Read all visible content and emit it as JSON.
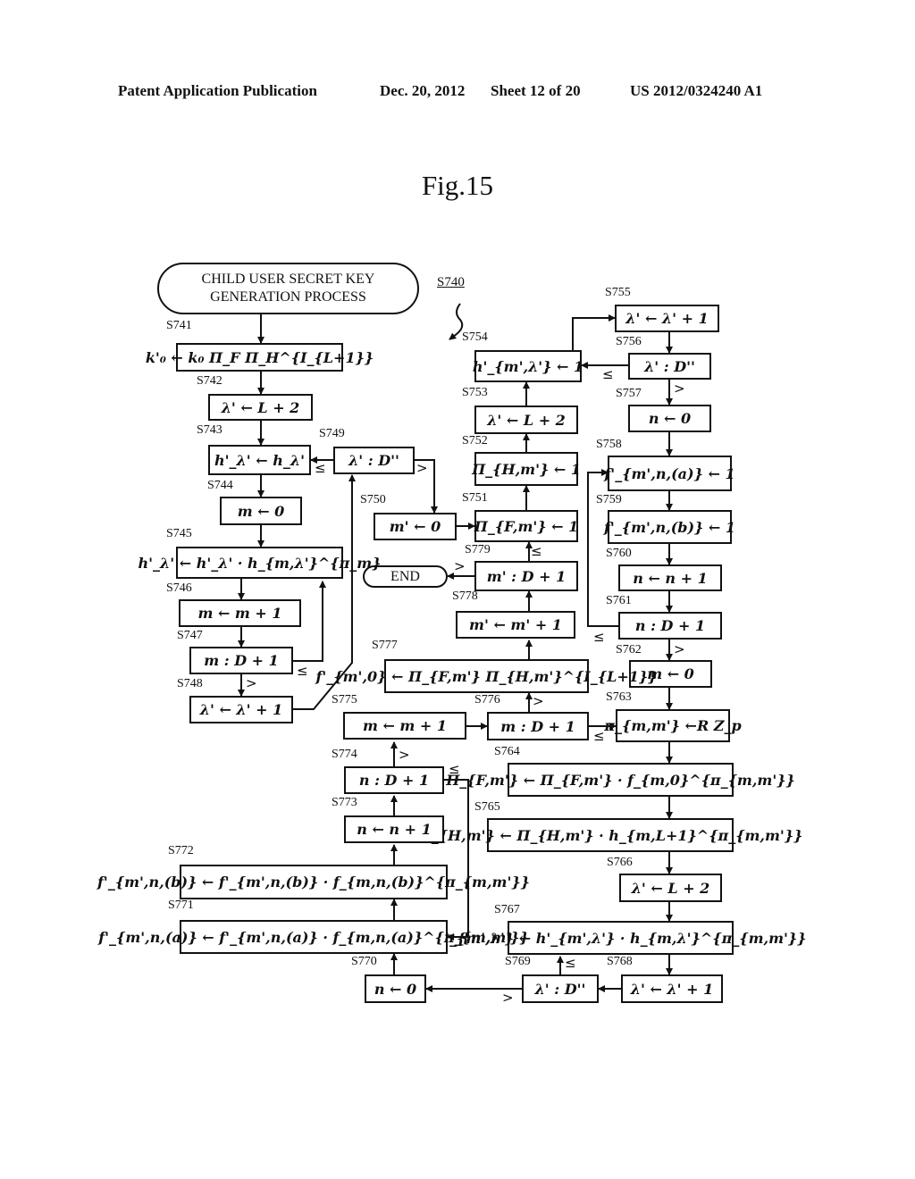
{
  "header": {
    "left": "Patent Application Publication",
    "date": "Dec. 20, 2012",
    "sheet": "Sheet 12 of 20",
    "pub_number": "US 2012/0324240 A1"
  },
  "figure": {
    "title": "Fig.15",
    "ref": "S740"
  },
  "terminals": {
    "start": "CHILD USER SECRET KEY GENERATION PROCESS",
    "end": "END"
  },
  "steps": {
    "S741": {
      "id": "S741",
      "text": "k'₀ ← k₀ Π_F Π_H^{I_{L+1}}"
    },
    "S742": {
      "id": "S742",
      "text": "λ' ← L + 2"
    },
    "S743": {
      "id": "S743",
      "text": "h'_λ' ← h_λ'"
    },
    "S744": {
      "id": "S744",
      "text": "m ← 0"
    },
    "S745": {
      "id": "S745",
      "text": "h'_λ' ← h'_λ' · h_{m,λ'}^{π_m}"
    },
    "S746": {
      "id": "S746",
      "text": "m ← m + 1"
    },
    "S747": {
      "id": "S747",
      "text": "m : D + 1"
    },
    "S748": {
      "id": "S748",
      "text": "λ' ← λ' + 1"
    },
    "S749": {
      "id": "S749",
      "text": "λ' : D''"
    },
    "S750": {
      "id": "S750",
      "text": "m' ← 0"
    },
    "S751": {
      "id": "S751",
      "text": "Π_{F,m'} ← 1"
    },
    "S752": {
      "id": "S752",
      "text": "Π_{H,m'} ← 1"
    },
    "S753": {
      "id": "S753",
      "text": "λ' ← L + 2"
    },
    "S754": {
      "id": "S754",
      "text": "h'_{m',λ'} ← 1"
    },
    "S755": {
      "id": "S755",
      "text": "λ' ← λ' + 1"
    },
    "S756": {
      "id": "S756",
      "text": "λ' : D''"
    },
    "S757": {
      "id": "S757",
      "text": "n ← 0"
    },
    "S758": {
      "id": "S758",
      "text": "f'_{m',n,(a)} ← 1"
    },
    "S759": {
      "id": "S759",
      "text": "f'_{m',n,(b)} ← 1"
    },
    "S760": {
      "id": "S760",
      "text": "n ← n + 1"
    },
    "S761": {
      "id": "S761",
      "text": "n : D + 1"
    },
    "S762": {
      "id": "S762",
      "text": "m ← 0"
    },
    "S763": {
      "id": "S763",
      "text": "π_{m,m'} ←R Z_p"
    },
    "S764": {
      "id": "S764",
      "text": "Π_{F,m'} ← Π_{F,m'} · f_{m,0}^{π_{m,m'}}"
    },
    "S765": {
      "id": "S765",
      "text": "Π_{H,m'} ← Π_{H,m'} · h_{m,L+1}^{π_{m,m'}}"
    },
    "S766": {
      "id": "S766",
      "text": "λ' ← L + 2"
    },
    "S767": {
      "id": "S767",
      "text": "h'_{m',λ'} ← h'_{m',λ'} · h_{m,λ'}^{π_{m,m'}}"
    },
    "S768": {
      "id": "S768",
      "text": "λ' ← λ' + 1"
    },
    "S769": {
      "id": "S769",
      "text": "λ' : D''"
    },
    "S770": {
      "id": "S770",
      "text": "n ← 0"
    },
    "S771": {
      "id": "S771",
      "text": "f'_{m',n,(a)} ← f'_{m',n,(a)} · f_{m,n,(a)}^{π_{m,m'}}"
    },
    "S772": {
      "id": "S772",
      "text": "f'_{m',n,(b)} ← f'_{m',n,(b)} · f_{m,n,(b)}^{π_{m,m'}}"
    },
    "S773": {
      "id": "S773",
      "text": "n ← n + 1"
    },
    "S774": {
      "id": "S774",
      "text": "n : D + 1"
    },
    "S775": {
      "id": "S775",
      "text": "m ← m + 1"
    },
    "S776": {
      "id": "S776",
      "text": "m : D + 1"
    },
    "S777": {
      "id": "S777",
      "text": "f'_{m',0} ← Π_{F,m'} Π_{H,m'}^{I_{L+1}}"
    },
    "S778": {
      "id": "S778",
      "text": "m' ← m' + 1"
    },
    "S779": {
      "id": "S779",
      "text": "m' : D + 1"
    }
  },
  "conditions": {
    "le": "≤",
    "gt": ">"
  }
}
